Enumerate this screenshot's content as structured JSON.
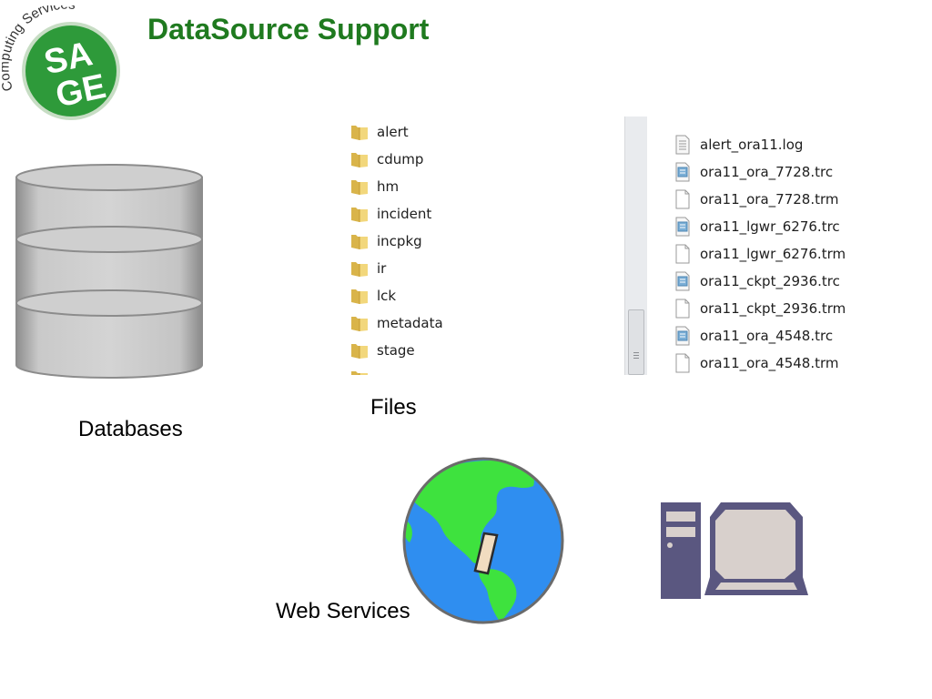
{
  "header": {
    "logo_text": "Computing Services",
    "logo_letters": [
      "SA",
      "GE"
    ],
    "title": "DataSource Support"
  },
  "databases": {
    "caption": "Databases"
  },
  "files": {
    "caption": "Files",
    "folders": [
      "alert",
      "cdump",
      "hm",
      "incident",
      "incpkg",
      "ir",
      "lck",
      "metadata",
      "stage"
    ],
    "items": [
      {
        "name": "alert_ora11.log",
        "icon": "log-file-icon"
      },
      {
        "name": "ora11_ora_7728.trc",
        "icon": "trace-file-icon"
      },
      {
        "name": "ora11_ora_7728.trm",
        "icon": "blank-file-icon"
      },
      {
        "name": "ora11_lgwr_6276.trc",
        "icon": "trace-file-icon"
      },
      {
        "name": "ora11_lgwr_6276.trm",
        "icon": "blank-file-icon"
      },
      {
        "name": "ora11_ckpt_2936.trc",
        "icon": "trace-file-icon"
      },
      {
        "name": "ora11_ckpt_2936.trm",
        "icon": "blank-file-icon"
      },
      {
        "name": "ora11_ora_4548.trc",
        "icon": "trace-file-icon"
      },
      {
        "name": "ora11_ora_4548.trm",
        "icon": "blank-file-icon"
      }
    ]
  },
  "web_services": {
    "caption": "Web Services"
  },
  "colors": {
    "title_green": "#1f7a1f",
    "logo_green": "#2e9a3a",
    "globe_ocean": "#2f8ef0",
    "globe_land": "#3ee23e",
    "computer_body": "#5a5780",
    "computer_screen": "#d8d0cc"
  }
}
